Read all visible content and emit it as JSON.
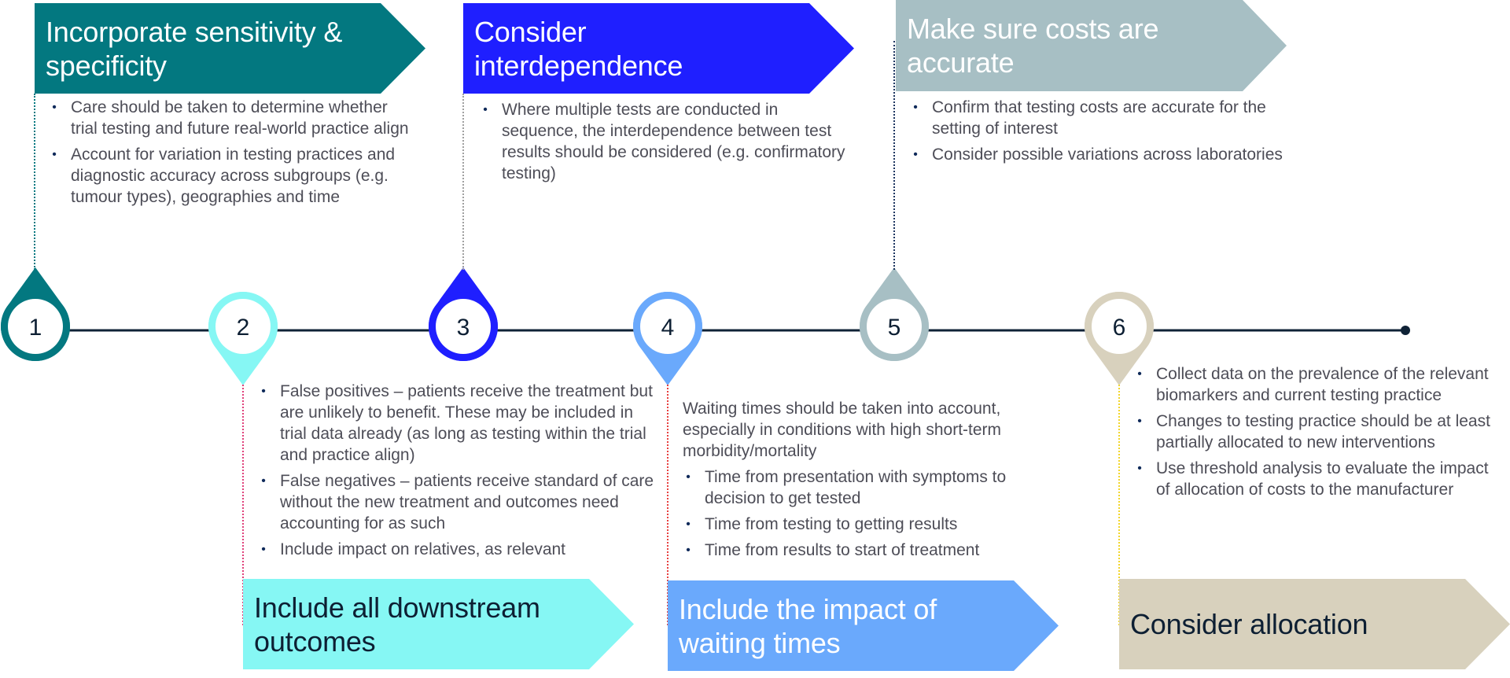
{
  "colors": {
    "teal": "#037880",
    "cyan": "#86f7f4",
    "blue": "#1f1fff",
    "light_blue": "#6aa9fc",
    "gray_blue": "#a7bfc4",
    "beige": "#d8d1bd",
    "navy": "#0f2236",
    "text_gray": "#4d4d57"
  },
  "steps": [
    {
      "number": "1",
      "title": "Incorporate sensitivity & specificity",
      "title_lines": [
        "Incorporate sensitivity &",
        "specificity"
      ],
      "intro": "",
      "bullets": [
        "Care should be taken to determine whether trial testing and future real-world practice align",
        "Account for variation in testing practices and diagnostic accuracy across subgroups (e.g. tumour types), geographies and time"
      ]
    },
    {
      "number": "2",
      "title": "Include all downstream outcomes",
      "title_lines": [
        "Include all downstream",
        "outcomes"
      ],
      "intro": "",
      "bullets": [
        "False positives – patients receive the treatment but are unlikely to benefit. These may be included in trial data already (as long as testing within the trial and practice align)",
        "False negatives – patients receive standard of care without the new treatment and outcomes need accounting for as such",
        "Include impact on relatives, as relevant"
      ]
    },
    {
      "number": "3",
      "title": "Consider interdependence",
      "title_lines": [
        "Consider",
        "interdependence"
      ],
      "intro": "",
      "bullets": [
        "Where multiple tests are conducted in sequence, the interdependence between test results should be considered (e.g. confirmatory testing)"
      ]
    },
    {
      "number": "4",
      "title": "Include the impact of waiting times",
      "title_lines": [
        "Include the impact of",
        "waiting times"
      ],
      "intro": "Waiting times should be taken into account, especially in conditions with high short-term morbidity/mortality",
      "bullets": [
        "Time from presentation with symptoms to decision to get tested",
        "Time from testing to getting results",
        "Time from results to start of treatment"
      ]
    },
    {
      "number": "5",
      "title": "Make sure costs are accurate",
      "title_lines": [
        "Make sure costs are",
        "accurate"
      ],
      "intro": "",
      "bullets": [
        "Confirm that testing costs are accurate for the setting of interest",
        "Consider possible variations across laboratories"
      ]
    },
    {
      "number": "6",
      "title": "Consider allocation",
      "title_lines": [
        "Consider allocation"
      ],
      "intro": "",
      "bullets": [
        "Collect data on the prevalence of the relevant biomarkers and current testing practice",
        "Changes to testing practice should be at least partially allocated to new interventions",
        "Use threshold analysis to evaluate the impact of allocation of costs to the manufacturer"
      ]
    }
  ],
  "bullet_glyph": "•"
}
